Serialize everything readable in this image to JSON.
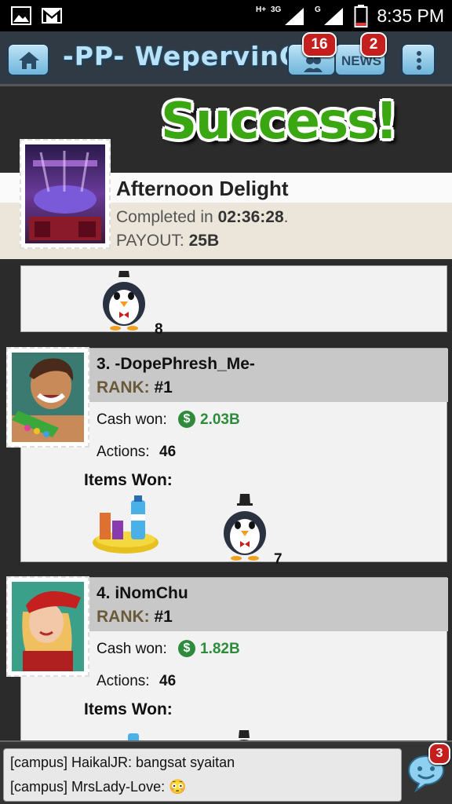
{
  "status_bar": {
    "time": "8:35 PM",
    "network_left": "H+",
    "network_3g": "3G",
    "network_g": "G"
  },
  "header": {
    "title": "-PP- WepervinCC",
    "friends_badge": "16",
    "news_label": "NEWS",
    "news_badge": "2"
  },
  "banner": {
    "text": "Success!"
  },
  "job": {
    "name": "Afternoon Delight",
    "completed_prefix": "Completed in ",
    "completed_time": "02:36:28",
    "completed_suffix": ".",
    "payout_label": "PAYOUT:",
    "payout_value": "25B"
  },
  "prev_card": {
    "item_count": "8"
  },
  "players": [
    {
      "name": "3. -DopePhresh_Me-",
      "rank_label": "RANK:",
      "rank_value": "#1",
      "cash_label": "Cash won:",
      "cash_value": "2.03B",
      "actions_label": "Actions:",
      "actions_value": "46",
      "items_label": "Items Won:",
      "item_count": "7"
    },
    {
      "name": "4. iNomChu",
      "rank_label": "RANK:",
      "rank_value": "#1",
      "cash_label": "Cash won:",
      "cash_value": "1.82B",
      "actions_label": "Actions:",
      "actions_value": "46",
      "items_label": "Items Won:"
    }
  ],
  "chat": {
    "lines": [
      "[campus] HaikalJR: bangsat syaitan",
      "[campus] MrsLady-Love: 😳"
    ],
    "badge": "3"
  },
  "colors": {
    "accent_green": "#3aa612",
    "cash_green": "#2d8b3b",
    "badge_red": "#c41e1e",
    "rank_brown": "#6b5a3a"
  }
}
